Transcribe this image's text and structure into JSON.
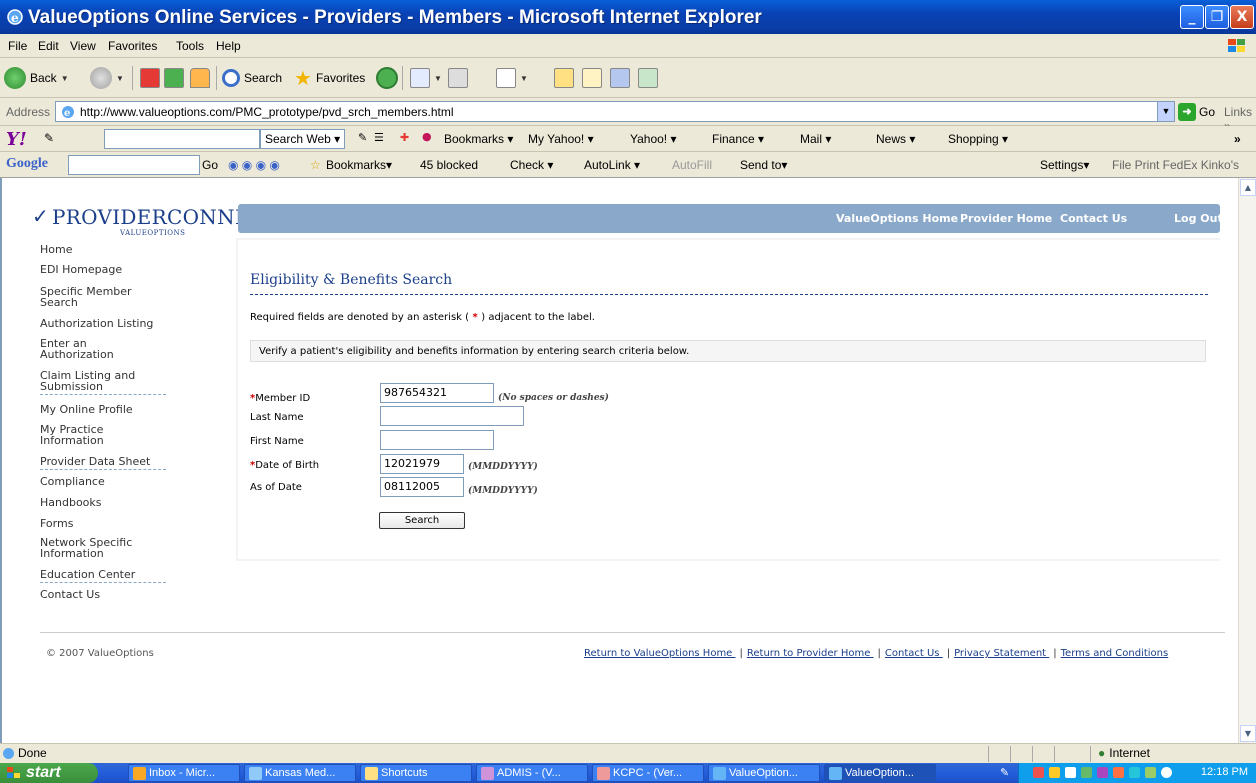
{
  "window": {
    "title": "ValueOptions Online Services - Providers - Members - Microsoft Internet Explorer",
    "minimize": "_",
    "restore": "❐",
    "close": "X"
  },
  "menu": [
    "File",
    "Edit",
    "View",
    "Favorites",
    "Tools",
    "Help"
  ],
  "toolbar": {
    "back": "Back",
    "search": "Search",
    "favorites": "Favorites"
  },
  "address": {
    "label": "Address",
    "url": "http://www.valueoptions.com/PMC_prototype/pvd_srch_members.html",
    "go": "Go",
    "links": "Links »"
  },
  "yahoo": {
    "logo": "Y!",
    "search_btn": "Search Web ▾",
    "items": [
      "Bookmarks ▾",
      "My Yahoo! ▾",
      "Yahoo! ▾",
      "Finance ▾",
      "Mail ▾",
      "News ▾",
      "Shopping ▾"
    ]
  },
  "google": {
    "logo": "Google",
    "go": "Go",
    "items": [
      "Bookmarks▾",
      "45 blocked",
      "Check ▾",
      "AutoLink ▾",
      "AutoFill",
      "Send to▾",
      "Settings▾",
      "File Print FedEx Kinko's"
    ]
  },
  "site": {
    "logo_name": "PROVIDERCONNECT",
    "logo_sub": "VALUEOPTIONS",
    "topnav": [
      "ValueOptions Home",
      "Provider Home",
      "Contact Us",
      "Log Out"
    ],
    "leftnav": [
      "Home",
      "EDI Homepage",
      "Specific Member Search",
      "Authorization Listing",
      "Enter an Authorization",
      "Claim Listing and Submission",
      "My Online Profile",
      "My Practice Information",
      "Provider Data Sheet",
      "Compliance",
      "Handbooks",
      "Forms",
      "Network Specific Information",
      "Education Center",
      "Contact Us"
    ]
  },
  "form": {
    "title": "Eligibility & Benefits Search",
    "required_pre": "Required fields are denoted by an asterisk (",
    "required_star": " * ",
    "required_post": ") adjacent to the label.",
    "instruction": "Verify a patient's eligibility and benefits information by entering search criteria below.",
    "fields": {
      "member_id": {
        "label": "Member ID",
        "value": "987654321",
        "hint": "(No spaces or dashes)"
      },
      "last_name": {
        "label": "Last Name",
        "value": ""
      },
      "first_name": {
        "label": "First Name",
        "value": ""
      },
      "dob": {
        "label": "Date of Birth",
        "value": "12021979",
        "hint": "(MMDDYYYY)"
      },
      "as_of": {
        "label": "As of Date",
        "value": "08112005",
        "hint": "(MMDDYYYY)"
      }
    },
    "star": "*",
    "search_label": "Search"
  },
  "footer": {
    "copyright": "© 2007 ValueOptions",
    "links": [
      "Return to ValueOptions Home ",
      "Return to Provider Home ",
      "Contact Us ",
      "Privacy Statement ",
      "Terms and Conditions"
    ]
  },
  "status": {
    "text": "Done",
    "zone": "Internet"
  },
  "taskbar": {
    "start": "start",
    "tasks": [
      "Inbox - Micr...",
      "Kansas Med...",
      "Shortcuts",
      "ADMIS - (V...",
      "KCPC - (Ver...",
      "ValueOption...",
      "ValueOption..."
    ],
    "clock": "12:18 PM"
  }
}
